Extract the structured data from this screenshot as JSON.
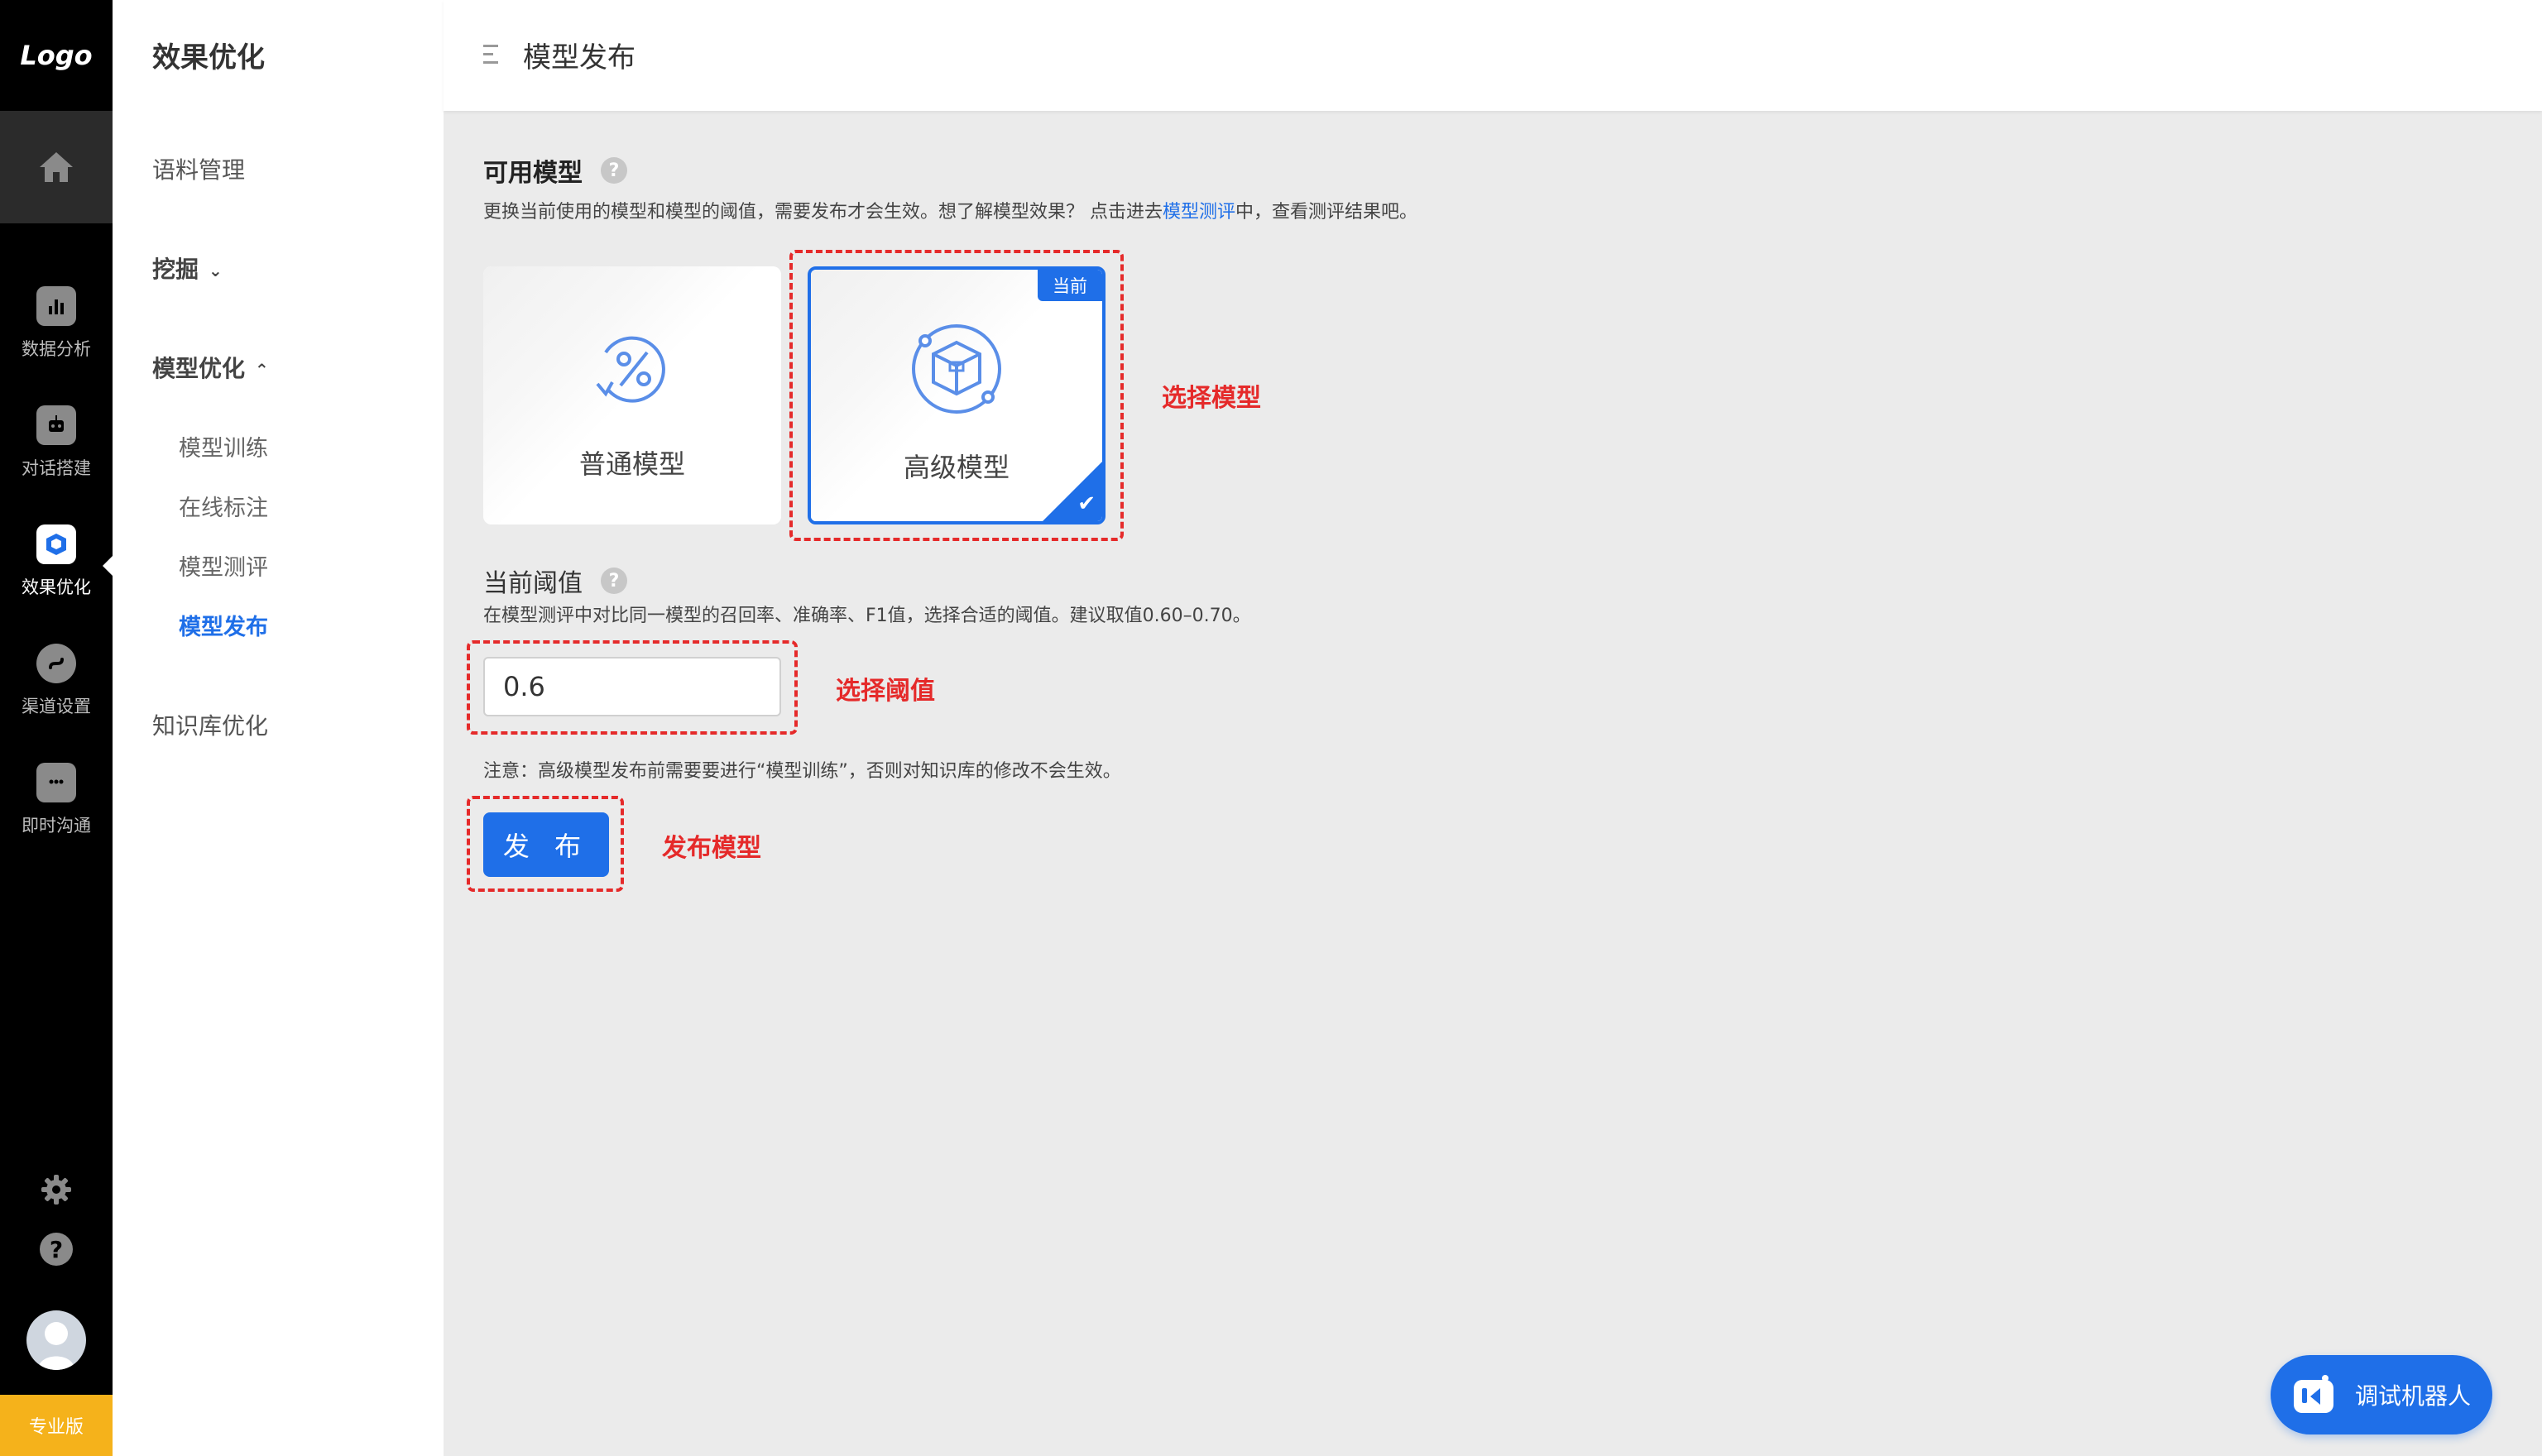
{
  "rail": {
    "logo": "Logo",
    "items": [
      {
        "label": "数据分析",
        "icon": "bar-chart-icon"
      },
      {
        "label": "对话搭建",
        "icon": "robot-icon"
      },
      {
        "label": "效果优化",
        "icon": "cube-icon",
        "active": true
      },
      {
        "label": "渠道设置",
        "icon": "channel-icon"
      },
      {
        "label": "即时沟通",
        "icon": "chat-bubble-icon"
      }
    ],
    "help": "?",
    "badge": "专业版"
  },
  "subnav": {
    "title": "效果优化",
    "items": {
      "corpus": "语料管理",
      "mining": "挖掘",
      "model_opt": "模型优化",
      "kb_opt": "知识库优化"
    },
    "children": [
      "模型训练",
      "在线标注",
      "模型测评",
      "模型发布"
    ]
  },
  "header": {
    "title": "模型发布"
  },
  "main": {
    "available": {
      "title": "可用模型",
      "help": "?",
      "desc_pre": "更换当前使用的模型和模型的阈值，需要发布才会生效。想了解模型效果？ 点击进去",
      "desc_link": "模型测评",
      "desc_post": "中，查看测评结果吧。"
    },
    "cards": {
      "normal": "普通模型",
      "advanced": "高级模型",
      "current_tag": "当前",
      "check": "✔"
    },
    "threshold": {
      "title": "当前阈值",
      "help": "?",
      "desc": "在模型测评中对比同一模型的召回率、准确率、F1值，选择合适的阈值。建议取值0.60–0.70。",
      "value": "0.6"
    },
    "note": "注意：高级模型发布前需要要进行“模型训练”，否则对知识库的修改不会生效。",
    "publish_label": "发 布",
    "annotations": {
      "select_model": "选择模型",
      "select_threshold": "选择阈值",
      "publish_model": "发布模型"
    }
  },
  "bot_button": "调试机器人",
  "colors": {
    "accent": "#1f6fe8",
    "annotation": "#e52a2a",
    "badge": "#f5b21b"
  }
}
